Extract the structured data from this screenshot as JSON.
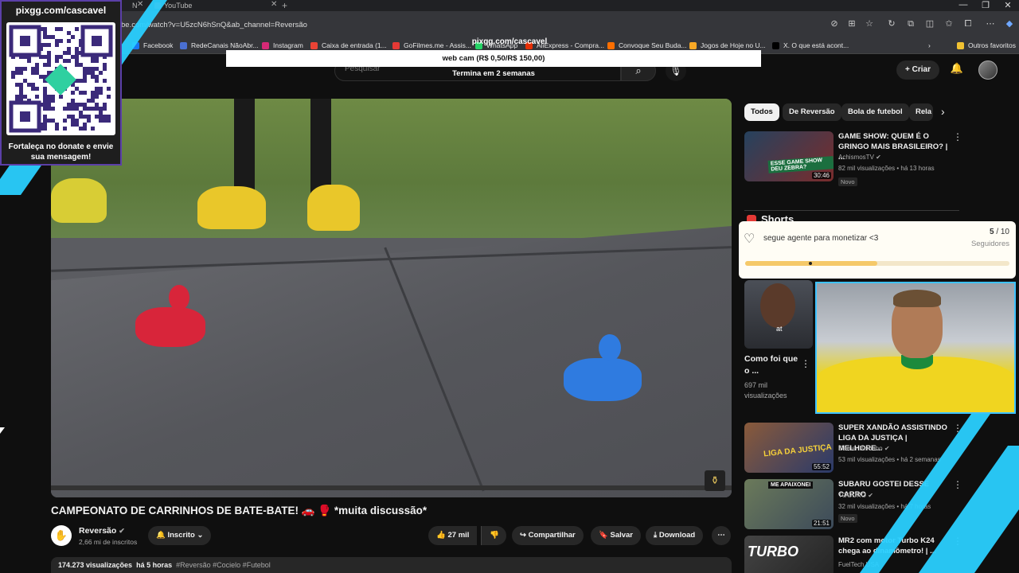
{
  "browser": {
    "tabs": [
      {
        "label": "N"
      },
      {
        "label": "YouTube"
      }
    ],
    "url": "be.com/watch?v=U5zcN6hSnQ&ab_channel=Reversão",
    "bookmarks": [
      {
        "label": "Facebook",
        "color": "#1877f2"
      },
      {
        "label": "RedeCanais NãoAbr...",
        "color": "#4a6fd1"
      },
      {
        "label": "Instagram",
        "color": "#d62976"
      },
      {
        "label": "Caixa de entrada (1...",
        "color": "#ea4335"
      },
      {
        "label": "GoFilmes.me - Assis...",
        "color": "#e53935"
      },
      {
        "label": "WhatsApp",
        "color": "#25d366"
      },
      {
        "label": "AliExpress - Compra...",
        "color": "#e62e04"
      },
      {
        "label": "Convoque Seu Buda...",
        "color": "#ff6f00"
      },
      {
        "label": "Jogos de Hoje no U...",
        "color": "#f9a825"
      },
      {
        "label": "X. O que está acont...",
        "color": "#000000"
      }
    ],
    "other_bookmarks": "Outros favoritos"
  },
  "youtube": {
    "search_placeholder": "Pesquisar",
    "create_label": "Criar"
  },
  "video": {
    "title": "CAMPEONATO DE CARRINHOS DE BATE-BATE! 🚗 🥊 *muita discussão*",
    "channel": "Reversão",
    "subscribers": "2,66 mi de inscritos",
    "subscribed_label": "Inscrito",
    "likes": "27 mil",
    "share_label": "Compartilhar",
    "save_label": "Salvar",
    "download_label": "Download",
    "views": "174.273 visualizações",
    "age": "há 5 horas",
    "tags": "#Reversão #Cocielo #Futebol"
  },
  "chips": [
    {
      "label": "Todos",
      "active": true
    },
    {
      "label": "De Reversão"
    },
    {
      "label": "Bola de futebol"
    },
    {
      "label": "Rela"
    }
  ],
  "recommendations": [
    {
      "title": "GAME SHOW: QUEM É O GRINGO MAIS BRASILEIRO? | ...",
      "channel": "AchismosTV",
      "meta": "82 mil visualizações • há 13 horas",
      "duration": "30:46",
      "badge": "Novo",
      "thumb_text": "ESSE GAME SHOW DEU ZEBRA?"
    },
    {
      "title": "SUPER XANDÃO ASSISTINDO LIGA DA JUSTIÇA | MELHORE...",
      "channel": "Gamer Bisonho",
      "meta": "53 mil visualizações • há 2 semanas",
      "duration": "55:52",
      "thumb_text": "LIGA DA JUSTIÇA"
    },
    {
      "title": "SUBARU GOSTEI DESSE CARRO",
      "channel": "TOGURO",
      "meta": "32 mil visualizações • há 7 horas",
      "duration": "21:51",
      "badge": "Novo",
      "thumb_text": "ME APAIXONEI"
    },
    {
      "title": "MR2 com motor Turbo K24 chega ao dinamômetro! | ...",
      "channel": "FuelTech USA",
      "thumb_text": "TURBO"
    }
  ],
  "shorts": {
    "label": "Shorts",
    "title": "Como foi que o ...",
    "views": "697 mil visualizações",
    "thumb_text": "at"
  },
  "overlays": {
    "qr_header": "pixgg.com/cascavel",
    "qr_footer": "Fortaleça no donate e envie sua mensagem!",
    "donate_site": "pixgg.com/cascavel",
    "donate_text": "web cam (R$ 0,50/R$ 150,00)",
    "donate_deadline": "Termina em 2 semanas",
    "goal_text": "segue agente para monetizar <3",
    "goal_current": "5",
    "goal_total": "/ 10",
    "goal_unit": "Seguidores",
    "goal_fraction": 0.5
  }
}
